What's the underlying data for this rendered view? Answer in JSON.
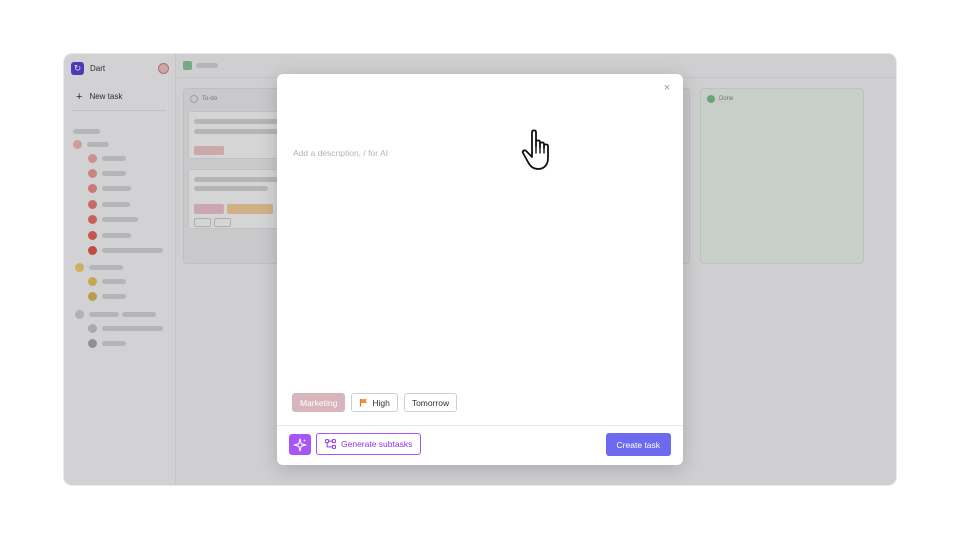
{
  "workspace": {
    "name": "Dart"
  },
  "sidebar": {
    "new_task_label": "New task"
  },
  "board": {
    "todo_label": "To-do",
    "done_label": "Done"
  },
  "modal": {
    "description_placeholder": "Add a description, / for AI",
    "close_symbol": "×",
    "chips": {
      "tag": "Marketing",
      "priority": "High",
      "due": "Tomorrow"
    },
    "generate_label": "Generate subtasks",
    "create_label": "Create task"
  },
  "colors": {
    "accent": "#6d6af0",
    "ai_purple": "#a855f7",
    "tag_marketing": "#d8b4bd",
    "priority_flag": "#f28c38",
    "brand": "#5b3fd6"
  },
  "icons": [
    "dart-logo-icon",
    "plus-icon",
    "close-icon",
    "flag-icon",
    "sparkle-icon",
    "subtasks-icon",
    "hand-cursor-icon"
  ]
}
